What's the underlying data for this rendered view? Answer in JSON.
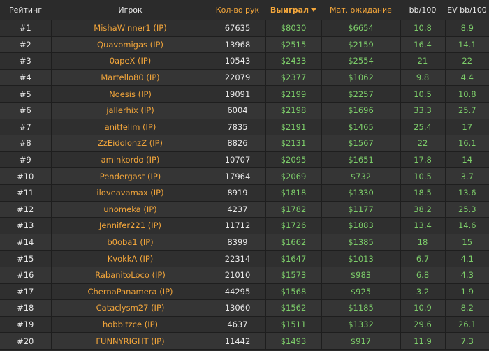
{
  "headers": {
    "rank": "Рейтинг",
    "player": "Игрок",
    "hands": "Кол-во рук",
    "won": "Выиграл",
    "ev": "Мат. ожидание",
    "bb100": "bb/100",
    "evbb100": "EV bb/100"
  },
  "colors": {
    "accent": "#f3a63b",
    "positive": "#7dce6a",
    "text": "#e8e8e8",
    "background": "#2b2b2b"
  },
  "rows": [
    {
      "rank": "#1",
      "player": "MishaWinner1 (IP)",
      "hands": "67635",
      "won": "$8030",
      "ev": "$6654",
      "bb100": "10.8",
      "evbb100": "8.9"
    },
    {
      "rank": "#2",
      "player": "Quavomigas (IP)",
      "hands": "13968",
      "won": "$2515",
      "ev": "$2159",
      "bb100": "16.4",
      "evbb100": "14.1"
    },
    {
      "rank": "#3",
      "player": "0apeX (IP)",
      "hands": "10543",
      "won": "$2433",
      "ev": "$2554",
      "bb100": "21",
      "evbb100": "22"
    },
    {
      "rank": "#4",
      "player": "Martello80 (IP)",
      "hands": "22079",
      "won": "$2377",
      "ev": "$1062",
      "bb100": "9.8",
      "evbb100": "4.4"
    },
    {
      "rank": "#5",
      "player": "Noesis (IP)",
      "hands": "19091",
      "won": "$2199",
      "ev": "$2257",
      "bb100": "10.5",
      "evbb100": "10.8"
    },
    {
      "rank": "#6",
      "player": "jallerhix (IP)",
      "hands": "6004",
      "won": "$2198",
      "ev": "$1696",
      "bb100": "33.3",
      "evbb100": "25.7"
    },
    {
      "rank": "#7",
      "player": "anitfelim (IP)",
      "hands": "7835",
      "won": "$2191",
      "ev": "$1465",
      "bb100": "25.4",
      "evbb100": "17"
    },
    {
      "rank": "#8",
      "player": "ZzEidolonzZ (IP)",
      "hands": "8826",
      "won": "$2131",
      "ev": "$1567",
      "bb100": "22",
      "evbb100": "16.1"
    },
    {
      "rank": "#9",
      "player": "aminkordo (IP)",
      "hands": "10707",
      "won": "$2095",
      "ev": "$1651",
      "bb100": "17.8",
      "evbb100": "14"
    },
    {
      "rank": "#10",
      "player": "Pendergast (IP)",
      "hands": "17964",
      "won": "$2069",
      "ev": "$732",
      "bb100": "10.5",
      "evbb100": "3.7"
    },
    {
      "rank": "#11",
      "player": "iloveavamax (IP)",
      "hands": "8919",
      "won": "$1818",
      "ev": "$1330",
      "bb100": "18.5",
      "evbb100": "13.6"
    },
    {
      "rank": "#12",
      "player": "unomeka (IP)",
      "hands": "4237",
      "won": "$1782",
      "ev": "$1177",
      "bb100": "38.2",
      "evbb100": "25.3"
    },
    {
      "rank": "#13",
      "player": "Jennifer221 (IP)",
      "hands": "11712",
      "won": "$1726",
      "ev": "$1883",
      "bb100": "13.4",
      "evbb100": "14.6"
    },
    {
      "rank": "#14",
      "player": "b0oba1 (IP)",
      "hands": "8399",
      "won": "$1662",
      "ev": "$1385",
      "bb100": "18",
      "evbb100": "15"
    },
    {
      "rank": "#15",
      "player": "KvokkA (IP)",
      "hands": "22314",
      "won": "$1647",
      "ev": "$1013",
      "bb100": "6.7",
      "evbb100": "4.1"
    },
    {
      "rank": "#16",
      "player": "RabanitoLoco (IP)",
      "hands": "21010",
      "won": "$1573",
      "ev": "$983",
      "bb100": "6.8",
      "evbb100": "4.3"
    },
    {
      "rank": "#17",
      "player": "ChernaPanamera (IP)",
      "hands": "44295",
      "won": "$1568",
      "ev": "$925",
      "bb100": "3.2",
      "evbb100": "1.9"
    },
    {
      "rank": "#18",
      "player": "Cataclysm27 (IP)",
      "hands": "13060",
      "won": "$1562",
      "ev": "$1185",
      "bb100": "10.9",
      "evbb100": "8.2"
    },
    {
      "rank": "#19",
      "player": "hobbitzce (IP)",
      "hands": "4637",
      "won": "$1511",
      "ev": "$1332",
      "bb100": "29.6",
      "evbb100": "26.1"
    },
    {
      "rank": "#20",
      "player": "FUNNYRIGHT (IP)",
      "hands": "11442",
      "won": "$1493",
      "ev": "$917",
      "bb100": "11.9",
      "evbb100": "7.3"
    }
  ]
}
